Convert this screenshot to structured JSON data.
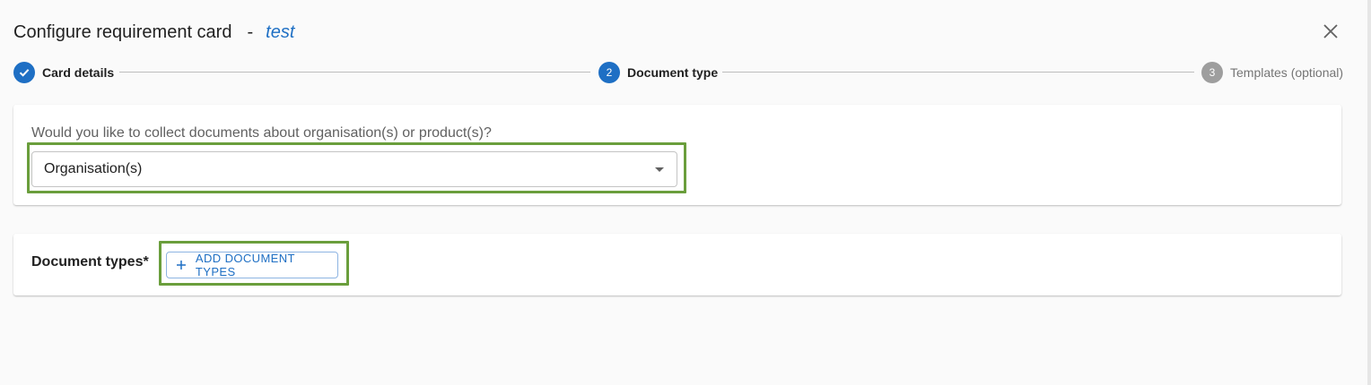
{
  "header": {
    "title": "Configure requirement card",
    "separator": "-",
    "card_name": "test"
  },
  "stepper": {
    "steps": [
      {
        "number": "",
        "label": "Card details",
        "state": "completed"
      },
      {
        "number": "2",
        "label": "Document type",
        "state": "active"
      },
      {
        "number": "3",
        "label": "Templates (optional)",
        "state": "pending"
      }
    ]
  },
  "collect_section": {
    "question": "Would you like to collect documents about organisation(s) or product(s)?",
    "selected_value": "Organisation(s)"
  },
  "document_types_section": {
    "label": "Document types*",
    "add_button_label": "ADD DOCUMENT TYPES"
  },
  "colors": {
    "accent": "#1e6fc4",
    "highlight": "#6a9e3c",
    "pending_step": "#9e9e9e"
  },
  "icons": [
    "check-icon",
    "close-icon",
    "chevron-down-icon",
    "plus-icon"
  ]
}
